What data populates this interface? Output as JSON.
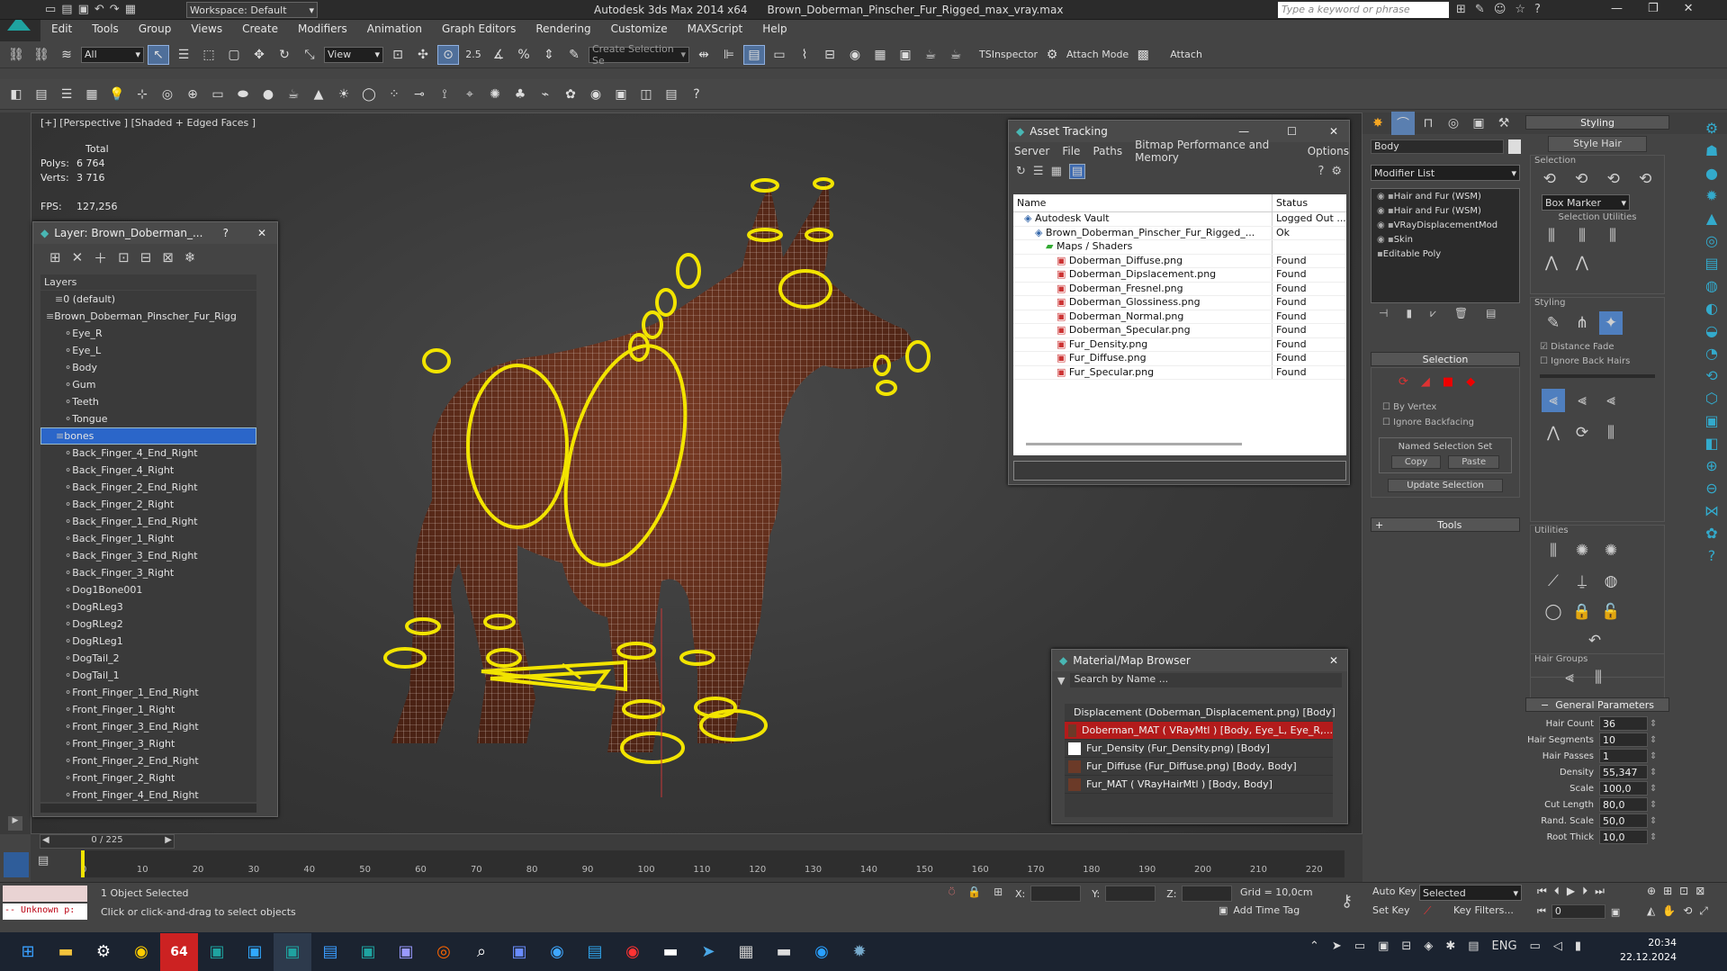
{
  "titlebar": {
    "workspace_label": "Workspace: Default",
    "app_title": "Autodesk 3ds Max  2014 x64",
    "file_name": "Brown_Doberman_Pinscher_Fur_Rigged_max_vray.max",
    "search_placeholder": "Type a keyword or phrase"
  },
  "menu": [
    "Edit",
    "Tools",
    "Group",
    "Views",
    "Create",
    "Modifiers",
    "Animation",
    "Graph Editors",
    "Rendering",
    "Customize",
    "MAXScript",
    "Help"
  ],
  "main_toolbar": {
    "filter_value": "All",
    "view_value": "View",
    "selection_set_placeholder": "Create Selection Se",
    "ts_inspector": "TSInspector",
    "attach_mode": "Attach Mode",
    "attach": "Attach",
    "snap_25": "2.5",
    "percent": "%"
  },
  "viewport": {
    "label": "[+] [Perspective ] [Shaded + Edged Faces ]",
    "stats_header": "Total",
    "polys_label": "Polys:",
    "polys_value": "6 764",
    "verts_label": "Verts:",
    "verts_value": "3 716",
    "fps_label": "FPS:",
    "fps_value": "127,256"
  },
  "layer_panel": {
    "title": "Layer: Brown_Doberman_...",
    "help": "?",
    "column": "Layers",
    "rows": [
      {
        "label": "0 (default)",
        "indent": 1
      },
      {
        "label": "Brown_Doberman_Pinscher_Fur_Rigg",
        "indent": 0
      },
      {
        "label": "Eye_R",
        "indent": 2
      },
      {
        "label": "Eye_L",
        "indent": 2
      },
      {
        "label": "Body",
        "indent": 2
      },
      {
        "label": "Gum",
        "indent": 2
      },
      {
        "label": "Teeth",
        "indent": 2
      },
      {
        "label": "Tongue",
        "indent": 2
      },
      {
        "label": "bones",
        "indent": 1,
        "selected": true
      },
      {
        "label": "Back_Finger_4_End_Right",
        "indent": 2
      },
      {
        "label": "Back_Finger_4_Right",
        "indent": 2
      },
      {
        "label": "Back_Finger_2_End_Right",
        "indent": 2
      },
      {
        "label": "Back_Finger_2_Right",
        "indent": 2
      },
      {
        "label": "Back_Finger_1_End_Right",
        "indent": 2
      },
      {
        "label": "Back_Finger_1_Right",
        "indent": 2
      },
      {
        "label": "Back_Finger_3_End_Right",
        "indent": 2
      },
      {
        "label": "Back_Finger_3_Right",
        "indent": 2
      },
      {
        "label": "Dog1Bone001",
        "indent": 2
      },
      {
        "label": "DogRLeg3",
        "indent": 2
      },
      {
        "label": "DogRLeg2",
        "indent": 2
      },
      {
        "label": "DogRLeg1",
        "indent": 2
      },
      {
        "label": "DogTail_2",
        "indent": 2
      },
      {
        "label": "DogTail_1",
        "indent": 2
      },
      {
        "label": "Front_Finger_1_End_Right",
        "indent": 2
      },
      {
        "label": "Front_Finger_1_Right",
        "indent": 2
      },
      {
        "label": "Front_Finger_3_End_Right",
        "indent": 2
      },
      {
        "label": "Front_Finger_3_Right",
        "indent": 2
      },
      {
        "label": "Front_Finger_2_End_Right",
        "indent": 2
      },
      {
        "label": "Front_Finger_2_Right",
        "indent": 2
      },
      {
        "label": "Front_Finger_4_End_Right",
        "indent": 2
      }
    ]
  },
  "asset_tracking": {
    "title": "Asset Tracking",
    "menu": [
      "Server",
      "File",
      "Paths",
      "Bitmap Performance and Memory",
      "Options"
    ],
    "col_name": "Name",
    "col_status": "Status",
    "rows": [
      {
        "name": "Autodesk Vault",
        "status": "Logged Out ...",
        "indent": 1
      },
      {
        "name": "Brown_Doberman_Pinscher_Fur_Rigged_...",
        "status": "Ok",
        "indent": 2
      },
      {
        "name": "Maps / Shaders",
        "status": "",
        "indent": 3
      },
      {
        "name": "Doberman_Diffuse.png",
        "status": "Found",
        "indent": 4
      },
      {
        "name": "Doberman_Dipslacement.png",
        "status": "Found",
        "indent": 4
      },
      {
        "name": "Doberman_Fresnel.png",
        "status": "Found",
        "indent": 4
      },
      {
        "name": "Doberman_Glossiness.png",
        "status": "Found",
        "indent": 4
      },
      {
        "name": "Doberman_Normal.png",
        "status": "Found",
        "indent": 4
      },
      {
        "name": "Doberman_Specular.png",
        "status": "Found",
        "indent": 4
      },
      {
        "name": "Fur_Density.png",
        "status": "Found",
        "indent": 4
      },
      {
        "name": "Fur_Diffuse.png",
        "status": "Found",
        "indent": 4
      },
      {
        "name": "Fur_Specular.png",
        "status": "Found",
        "indent": 4
      }
    ]
  },
  "material_browser": {
    "title": "Material/Map Browser",
    "search_placeholder": "Search by Name ...",
    "rows": [
      {
        "label": "Displacement (Doberman_Displacement.png) [Body]",
        "selected": false
      },
      {
        "label": "Doberman_MAT  ( VRayMtl ) [Body, Eye_L, Eye_R,...",
        "selected": true
      },
      {
        "label": "Fur_Density (Fur_Density.png) [Body]",
        "selected": false
      },
      {
        "label": "Fur_Diffuse (Fur_Diffuse.png) [Body, Body]",
        "selected": false
      },
      {
        "label": "Fur_MAT  ( VRayHairMtl ) [Body, Body]",
        "selected": false
      }
    ]
  },
  "modify_panel": {
    "object_name": "Body",
    "modifier_list": "Modifier List",
    "stack": [
      "Hair and Fur (WSM)",
      "Hair and Fur (WSM)",
      "VRayDisplacementMod",
      "Skin",
      "Editable Poly"
    ],
    "selection_title": "Selection",
    "by_vertex": "By Vertex",
    "ignore_backfacing": "Ignore Backfacing",
    "named_sel": "Named Selection Set",
    "copy": "Copy",
    "paste": "Paste",
    "update_selection": "Update Selection",
    "tools": "Tools"
  },
  "styling_panel": {
    "title": "Styling",
    "style_hair": "Style Hair",
    "selection": "Selection",
    "box_marker": "Box Marker",
    "selection_utilities": "Selection Utilities",
    "styling": "Styling",
    "distance_fade": "Distance Fade",
    "ignore_back_hairs": "Ignore Back Hairs",
    "utilities": "Utilities",
    "hair_groups": "Hair Groups",
    "general_parameters": "General Parameters",
    "params": [
      {
        "label": "Hair Count",
        "value": "36"
      },
      {
        "label": "Hair Segments",
        "value": "10"
      },
      {
        "label": "Hair Passes",
        "value": "1"
      },
      {
        "label": "Density",
        "value": "55,347"
      },
      {
        "label": "Scale",
        "value": "100,0"
      },
      {
        "label": "Cut Length",
        "value": "80,0"
      },
      {
        "label": "Rand. Scale",
        "value": "50,0"
      },
      {
        "label": "Root Thick",
        "value": "10,0"
      }
    ]
  },
  "timeline": {
    "frame": "0 / 225",
    "ticks": [
      "0",
      "10",
      "20",
      "30",
      "40",
      "50",
      "60",
      "70",
      "80",
      "90",
      "100",
      "110",
      "120",
      "130",
      "140",
      "150",
      "160",
      "170",
      "180",
      "190",
      "200",
      "210",
      "220"
    ]
  },
  "status": {
    "maxscript": "-- Unknown p:",
    "objects_selected": "1 Object Selected",
    "prompt": "Click or click-and-drag to select objects",
    "x_label": "X:",
    "y_label": "Y:",
    "z_label": "Z:",
    "grid": "Grid = 10,0cm",
    "add_time_tag": "Add Time Tag",
    "auto_key": "Auto Key",
    "set_key": "Set Key",
    "selected": "Selected",
    "key_filters": "Key Filters...",
    "frame_value": "0"
  },
  "taskbar": {
    "lang": "ENG",
    "time": "20:34",
    "date": "22.12.2024",
    "badge_64": "64"
  },
  "colors": {
    "bone_yellow": "#f2e400",
    "selected_blue": "#2b66c9",
    "selected_red": "#b31b1b",
    "accent": "#4f6f9a"
  }
}
